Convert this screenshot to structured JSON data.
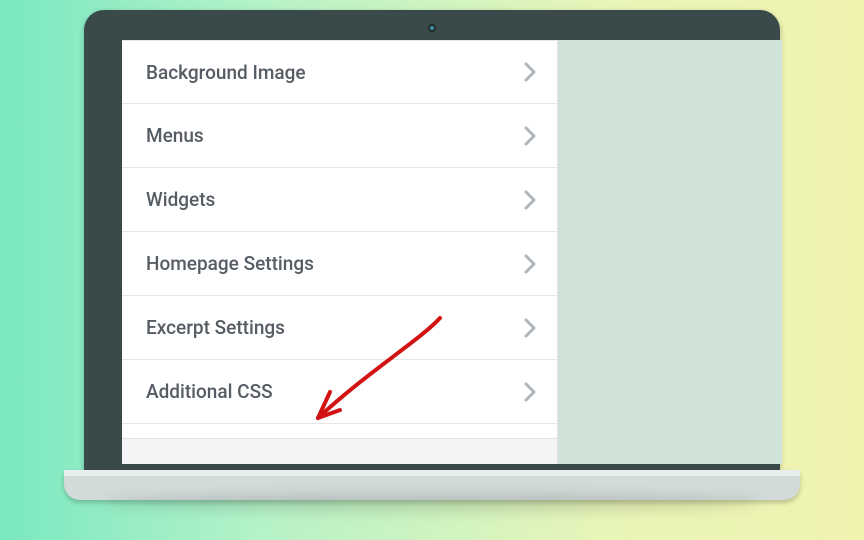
{
  "customizer": {
    "items": [
      {
        "label": "Background Image"
      },
      {
        "label": "Menus"
      },
      {
        "label": "Widgets"
      },
      {
        "label": "Homepage Settings"
      },
      {
        "label": "Excerpt Settings"
      },
      {
        "label": "Additional CSS"
      }
    ]
  }
}
